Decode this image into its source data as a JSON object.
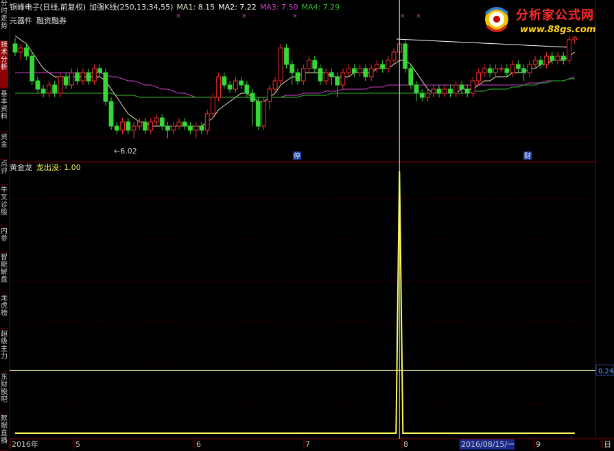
{
  "header": {
    "stock": "铜峰电子(日线,前复权)",
    "indicator": "加强K线(250,13,34,55)",
    "ma1": "MA1: 8.15",
    "ma2": "MA2: 7.22",
    "ma3": "MA3: 7.50",
    "ma4": "MA4: 7.29"
  },
  "subheader": {
    "item1": "元器件",
    "item2": "融资融券"
  },
  "sidebar": {
    "tabs": [
      "分时走势",
      "技术分析",
      "基本资料",
      "资金",
      "点评",
      "牛叉诊股",
      "内参",
      "智能解盘",
      "龙虎榜",
      "超级主力",
      "东财股吧",
      "数据直播"
    ],
    "active_index": 1
  },
  "logo": {
    "title": "分析家公式网",
    "url": "www.88gs.com"
  },
  "colors": {
    "up": "#ff3030",
    "down": "#36d836",
    "ma1": "#e8e8c8",
    "ma2": "#ffffff",
    "ma3": "#d040d0",
    "ma4": "#30c030",
    "signal": "#ffff60",
    "axis": "#8b0000"
  },
  "panel2": {
    "name": "黄金龙",
    "label": "龙出没: 1.00"
  },
  "annotations": {
    "low_price": "6.02",
    "event1": "停",
    "event2": "财",
    "right_value": "0.24"
  },
  "date_axis": [
    "2016年",
    "5",
    "6",
    "7",
    "8",
    "2016/08/15/一",
    "9",
    "日"
  ],
  "chart_data": [
    {
      "type": "candlestick",
      "title": "铜峰电子(日线,前复权)",
      "ylim": [
        5.8,
        9.0
      ],
      "series_names": [
        "MA1",
        "MA2",
        "MA3",
        "MA4"
      ],
      "candles": [
        [
          8.6,
          8.4,
          8.75,
          8.3
        ],
        [
          8.4,
          8.5,
          8.6,
          8.2
        ],
        [
          8.5,
          8.3,
          8.6,
          8.2
        ],
        [
          8.3,
          7.7,
          8.4,
          7.6
        ],
        [
          7.7,
          7.5,
          7.8,
          7.4
        ],
        [
          7.5,
          7.4,
          7.6,
          7.3
        ],
        [
          7.4,
          7.6,
          7.7,
          7.3
        ],
        [
          7.6,
          7.4,
          7.7,
          7.3
        ],
        [
          7.4,
          7.8,
          7.9,
          7.3
        ],
        [
          7.8,
          7.6,
          7.9,
          7.5
        ],
        [
          7.6,
          7.9,
          8.0,
          7.5
        ],
        [
          7.9,
          7.7,
          8.0,
          7.6
        ],
        [
          7.7,
          7.9,
          8.0,
          7.6
        ],
        [
          7.9,
          7.7,
          8.0,
          7.6
        ],
        [
          7.7,
          8.0,
          8.1,
          7.6
        ],
        [
          8.0,
          7.9,
          8.1,
          7.8
        ],
        [
          7.9,
          7.2,
          8.0,
          7.1
        ],
        [
          7.2,
          6.6,
          7.3,
          6.5
        ],
        [
          6.6,
          6.5,
          6.7,
          6.4
        ],
        [
          6.5,
          6.7,
          6.8,
          6.4
        ],
        [
          6.7,
          6.5,
          6.8,
          6.4
        ],
        [
          6.5,
          6.6,
          6.7,
          6.3
        ],
        [
          6.6,
          6.7,
          6.8,
          6.5
        ],
        [
          6.7,
          6.5,
          6.8,
          6.4
        ],
        [
          6.5,
          6.7,
          6.8,
          6.4
        ],
        [
          6.7,
          6.8,
          6.9,
          6.6
        ],
        [
          6.8,
          6.6,
          6.9,
          6.5
        ],
        [
          6.6,
          6.5,
          6.7,
          6.3
        ],
        [
          6.5,
          6.6,
          6.7,
          6.4
        ],
        [
          6.6,
          6.7,
          6.8,
          6.5
        ],
        [
          6.7,
          6.6,
          6.8,
          6.5
        ],
        [
          6.6,
          6.5,
          6.7,
          6.4
        ],
        [
          6.5,
          6.6,
          6.7,
          6.3
        ],
        [
          6.6,
          6.5,
          6.7,
          6.4
        ],
        [
          6.5,
          6.9,
          7.0,
          6.4
        ],
        [
          6.9,
          7.3,
          7.4,
          6.8
        ],
        [
          7.3,
          7.8,
          7.9,
          7.2
        ],
        [
          7.8,
          7.6,
          7.9,
          7.5
        ],
        [
          7.6,
          7.5,
          7.7,
          7.4
        ],
        [
          7.5,
          7.7,
          7.8,
          7.4
        ],
        [
          7.7,
          7.6,
          7.8,
          7.5
        ],
        [
          7.6,
          7.4,
          7.7,
          7.3
        ],
        [
          7.4,
          7.2,
          7.5,
          6.6
        ],
        [
          7.2,
          6.6,
          7.3,
          6.5
        ],
        [
          6.6,
          7.2,
          7.3,
          6.5
        ],
        [
          7.2,
          7.5,
          7.6,
          7.0
        ],
        [
          7.5,
          7.7,
          7.8,
          7.4
        ],
        [
          7.7,
          8.5,
          8.6,
          7.6
        ],
        [
          8.5,
          8.1,
          8.6,
          8.0
        ],
        [
          8.1,
          7.9,
          8.2,
          7.6
        ],
        [
          7.9,
          7.7,
          8.0,
          7.6
        ],
        [
          7.7,
          8.0,
          8.1,
          7.6
        ],
        [
          8.0,
          8.2,
          8.3,
          7.9
        ],
        [
          8.2,
          8.0,
          8.3,
          7.9
        ],
        [
          8.0,
          7.7,
          8.1,
          7.6
        ],
        [
          7.7,
          7.9,
          8.0,
          7.6
        ],
        [
          7.9,
          7.8,
          8.0,
          7.6
        ],
        [
          7.8,
          7.6,
          7.9,
          7.3
        ],
        [
          7.6,
          7.9,
          8.0,
          7.5
        ],
        [
          7.9,
          8.0,
          8.1,
          7.8
        ],
        [
          8.0,
          7.9,
          8.1,
          7.8
        ],
        [
          7.9,
          8.0,
          8.1,
          7.8
        ],
        [
          8.0,
          7.8,
          8.1,
          7.7
        ],
        [
          7.8,
          8.0,
          8.1,
          7.7
        ],
        [
          8.0,
          8.1,
          8.2,
          7.9
        ],
        [
          8.1,
          8.0,
          8.2,
          7.9
        ],
        [
          8.0,
          8.2,
          8.3,
          7.9
        ],
        [
          8.2,
          8.4,
          8.5,
          8.1
        ],
        [
          8.4,
          8.6,
          8.7,
          8.3
        ],
        [
          8.6,
          8.0,
          8.7,
          7.9
        ],
        [
          8.0,
          7.6,
          8.1,
          7.5
        ],
        [
          7.6,
          7.4,
          7.7,
          7.2
        ],
        [
          7.4,
          7.3,
          7.5,
          7.2
        ],
        [
          7.3,
          7.4,
          7.5,
          7.2
        ],
        [
          7.4,
          7.5,
          7.6,
          7.3
        ],
        [
          7.5,
          7.4,
          7.6,
          7.3
        ],
        [
          7.4,
          7.5,
          7.6,
          7.3
        ],
        [
          7.5,
          7.4,
          7.6,
          7.3
        ],
        [
          7.4,
          7.6,
          7.7,
          7.3
        ],
        [
          7.6,
          7.5,
          7.7,
          7.4
        ],
        [
          7.5,
          7.4,
          7.6,
          7.3
        ],
        [
          7.4,
          7.7,
          7.8,
          7.3
        ],
        [
          7.7,
          7.9,
          8.0,
          7.6
        ],
        [
          7.9,
          8.0,
          8.1,
          7.8
        ],
        [
          8.0,
          7.9,
          8.1,
          7.8
        ],
        [
          7.9,
          8.0,
          8.1,
          7.8
        ],
        [
          8.0,
          8.0,
          8.1,
          7.9
        ],
        [
          8.0,
          7.9,
          8.1,
          7.8
        ],
        [
          7.9,
          8.1,
          8.2,
          7.8
        ],
        [
          8.1,
          8.0,
          8.2,
          7.9
        ],
        [
          8.0,
          7.9,
          8.1,
          7.7
        ],
        [
          7.9,
          8.1,
          8.2,
          7.8
        ],
        [
          8.1,
          8.2,
          8.3,
          8.0
        ],
        [
          8.2,
          8.1,
          8.3,
          8.0
        ],
        [
          8.1,
          8.3,
          8.4,
          8.0
        ],
        [
          8.3,
          8.2,
          8.4,
          8.1
        ],
        [
          8.2,
          8.3,
          8.4,
          8.1
        ],
        [
          8.3,
          8.2,
          8.4,
          8.1
        ],
        [
          8.2,
          8.7,
          8.8,
          8.1
        ],
        [
          8.7,
          8.75,
          8.8,
          8.6
        ]
      ],
      "ma_lines": {
        "MA1": [
          8.8,
          8.7,
          8.6,
          8.4,
          8.2,
          8.0,
          7.9,
          7.8,
          7.8,
          7.8,
          7.8,
          7.8,
          7.8,
          7.8,
          7.8,
          7.8,
          7.7,
          7.5,
          7.3,
          7.1,
          6.9,
          6.8,
          6.7,
          6.7,
          6.6,
          6.6,
          6.6,
          6.6,
          6.6,
          6.6,
          6.6,
          6.6,
          6.6,
          6.6,
          6.7,
          6.8,
          7.0,
          7.1,
          7.2,
          7.3,
          7.4,
          7.4,
          7.3,
          7.2,
          7.2,
          7.3,
          7.4,
          7.6,
          7.7,
          7.8,
          7.8,
          7.9,
          7.9,
          7.9,
          7.9,
          7.9,
          7.8,
          7.8,
          7.8,
          7.8,
          7.9,
          7.9,
          7.9,
          7.9,
          8.0,
          8.0,
          8.0,
          8.1,
          8.2,
          8.2,
          8.1,
          7.9,
          7.7,
          7.5,
          7.4,
          7.4,
          7.4,
          7.4,
          7.4,
          7.5,
          7.5,
          7.5,
          7.6,
          7.7,
          7.7,
          7.8,
          7.8,
          7.8,
          7.9,
          7.9,
          7.9,
          8.0,
          8.0,
          8.1,
          8.1,
          8.2,
          8.2,
          8.2,
          8.3,
          8.4
        ],
        "MA3": [
          7.9,
          7.9,
          7.9,
          7.9,
          7.9,
          7.9,
          7.9,
          7.9,
          7.9,
          7.9,
          7.9,
          7.9,
          7.9,
          7.9,
          7.9,
          7.9,
          7.85,
          7.8,
          7.8,
          7.75,
          7.7,
          7.7,
          7.65,
          7.6,
          7.6,
          7.55,
          7.5,
          7.5,
          7.45,
          7.4,
          7.4,
          7.35,
          7.3,
          7.3,
          7.3,
          7.3,
          7.3,
          7.3,
          7.3,
          7.3,
          7.3,
          7.3,
          7.3,
          7.3,
          7.3,
          7.3,
          7.3,
          7.3,
          7.35,
          7.35,
          7.35,
          7.4,
          7.4,
          7.4,
          7.4,
          7.45,
          7.45,
          7.45,
          7.5,
          7.5,
          7.5,
          7.5,
          7.5,
          7.55,
          7.55,
          7.55,
          7.6,
          7.6,
          7.6,
          7.6,
          7.6,
          7.6,
          7.6,
          7.6,
          7.6,
          7.6,
          7.6,
          7.6,
          7.6,
          7.6,
          7.6,
          7.6,
          7.6,
          7.6,
          7.6,
          7.6,
          7.6,
          7.6,
          7.6,
          7.6,
          7.6,
          7.65,
          7.65,
          7.65,
          7.7,
          7.7,
          7.7,
          7.7,
          7.75,
          7.8
        ],
        "MA4": [
          7.4,
          7.4,
          7.4,
          7.4,
          7.4,
          7.4,
          7.4,
          7.4,
          7.4,
          7.4,
          7.4,
          7.4,
          7.4,
          7.4,
          7.4,
          7.4,
          7.4,
          7.4,
          7.35,
          7.35,
          7.35,
          7.35,
          7.3,
          7.3,
          7.3,
          7.3,
          7.3,
          7.3,
          7.3,
          7.3,
          7.3,
          7.3,
          7.3,
          7.3,
          7.3,
          7.3,
          7.3,
          7.3,
          7.3,
          7.3,
          7.3,
          7.3,
          7.3,
          7.3,
          7.3,
          7.3,
          7.3,
          7.3,
          7.3,
          7.3,
          7.3,
          7.35,
          7.35,
          7.35,
          7.35,
          7.35,
          7.4,
          7.4,
          7.4,
          7.4,
          7.4,
          7.4,
          7.4,
          7.4,
          7.4,
          7.4,
          7.4,
          7.4,
          7.4,
          7.4,
          7.4,
          7.4,
          7.4,
          7.4,
          7.4,
          7.4,
          7.4,
          7.4,
          7.4,
          7.4,
          7.4,
          7.45,
          7.45,
          7.45,
          7.5,
          7.5,
          7.5,
          7.5,
          7.55,
          7.55,
          7.6,
          7.6,
          7.6,
          7.65,
          7.65,
          7.7,
          7.7,
          7.7,
          7.75,
          7.75
        ]
      }
    },
    {
      "type": "line",
      "title": "黄金龙",
      "ylim": [
        0,
        1.0
      ],
      "signal_name": "龙出没",
      "signal_index": 68,
      "values_note_value": 1.0,
      "reference_line": 0.24
    }
  ]
}
